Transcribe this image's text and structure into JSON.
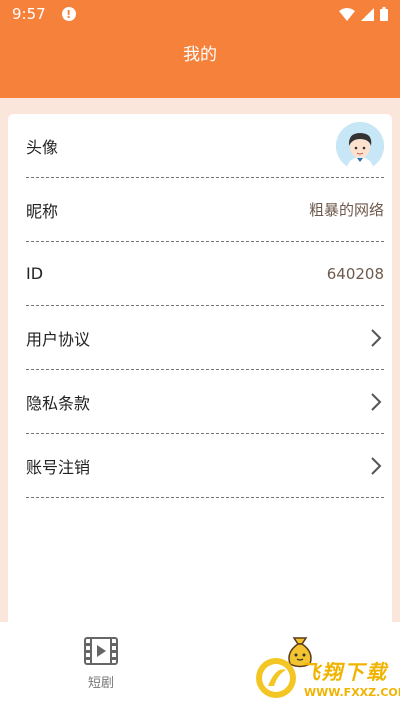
{
  "status_bar": {
    "time": "9:57",
    "alert_icon": "!"
  },
  "header": {
    "title": "我的"
  },
  "settings": {
    "rows": [
      {
        "label": "头像",
        "type": "avatar"
      },
      {
        "label": "昵称",
        "value": "粗暴的网络"
      },
      {
        "label": "ID",
        "value": "640208"
      },
      {
        "label": "用户协议",
        "type": "link"
      },
      {
        "label": "隐私条款",
        "type": "link"
      },
      {
        "label": "账号注销",
        "type": "link"
      }
    ]
  },
  "tabbar": {
    "tabs": [
      {
        "label": "短剧",
        "icon": "film-play-icon"
      },
      {
        "label": "",
        "icon": "money-bag-icon"
      }
    ]
  },
  "watermark": {
    "title": "飞翔下载",
    "url": "WWW.FXXZ.COM"
  },
  "colors": {
    "accent": "#f5813a",
    "background": "#fbe6dc",
    "value_text": "#6e5a4c"
  }
}
